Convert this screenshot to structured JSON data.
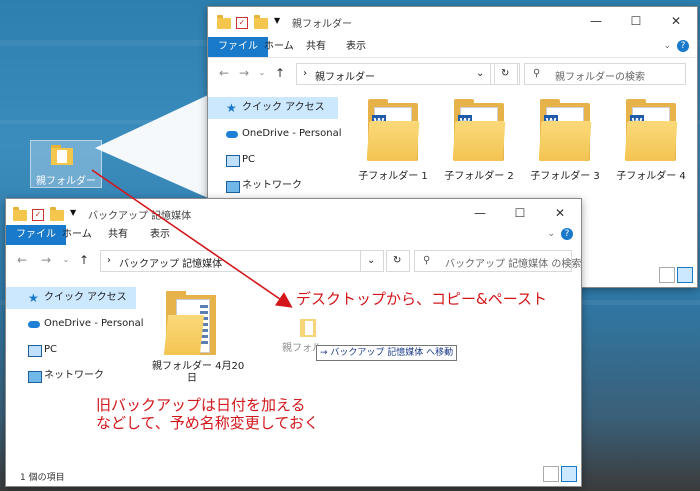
{
  "desktop": {
    "folder_label": "親フォルダー"
  },
  "parent_window": {
    "title": "親フォルダー",
    "tabs": [
      "ファイル",
      "ホーム",
      "共有",
      "表示"
    ],
    "path": "親フォルダー",
    "search_placeholder": "親フォルダーの検索",
    "nav": [
      "クイック アクセス",
      "OneDrive - Personal",
      "PC",
      "ネットワーク"
    ],
    "items": [
      "子フォルダー 1",
      "子フォルダー 2",
      "子フォルダー 3",
      "子フォルダー 4"
    ]
  },
  "backup_window": {
    "title": "バックアップ 記憶媒体",
    "tabs": [
      "ファイル",
      "ホーム",
      "共有",
      "表示"
    ],
    "path": "バックアップ 記憶媒体",
    "search_placeholder": "バックアップ 記憶媒体 の検索",
    "nav": [
      "クイック アクセス",
      "OneDrive - Personal",
      "PC",
      "ネットワーク"
    ],
    "folder_label_line1": "親フォルダー 4月20",
    "folder_label_line2": "日",
    "status": "1 個の項目",
    "drag_ghost_label": "親フォル",
    "drag_tooltip": "→ バックアップ 記憶媒体 へ移動"
  },
  "annotations": {
    "copy_paste": "デスクトップから、コピー&ペースト",
    "rename_line1": "旧バックアップは日付を加える",
    "rename_line2": "などして、予め名称変更しておく"
  },
  "colors": {
    "accent": "#1979ca",
    "annotation": "#d3161b",
    "nav_selected": "#cce8ff"
  }
}
